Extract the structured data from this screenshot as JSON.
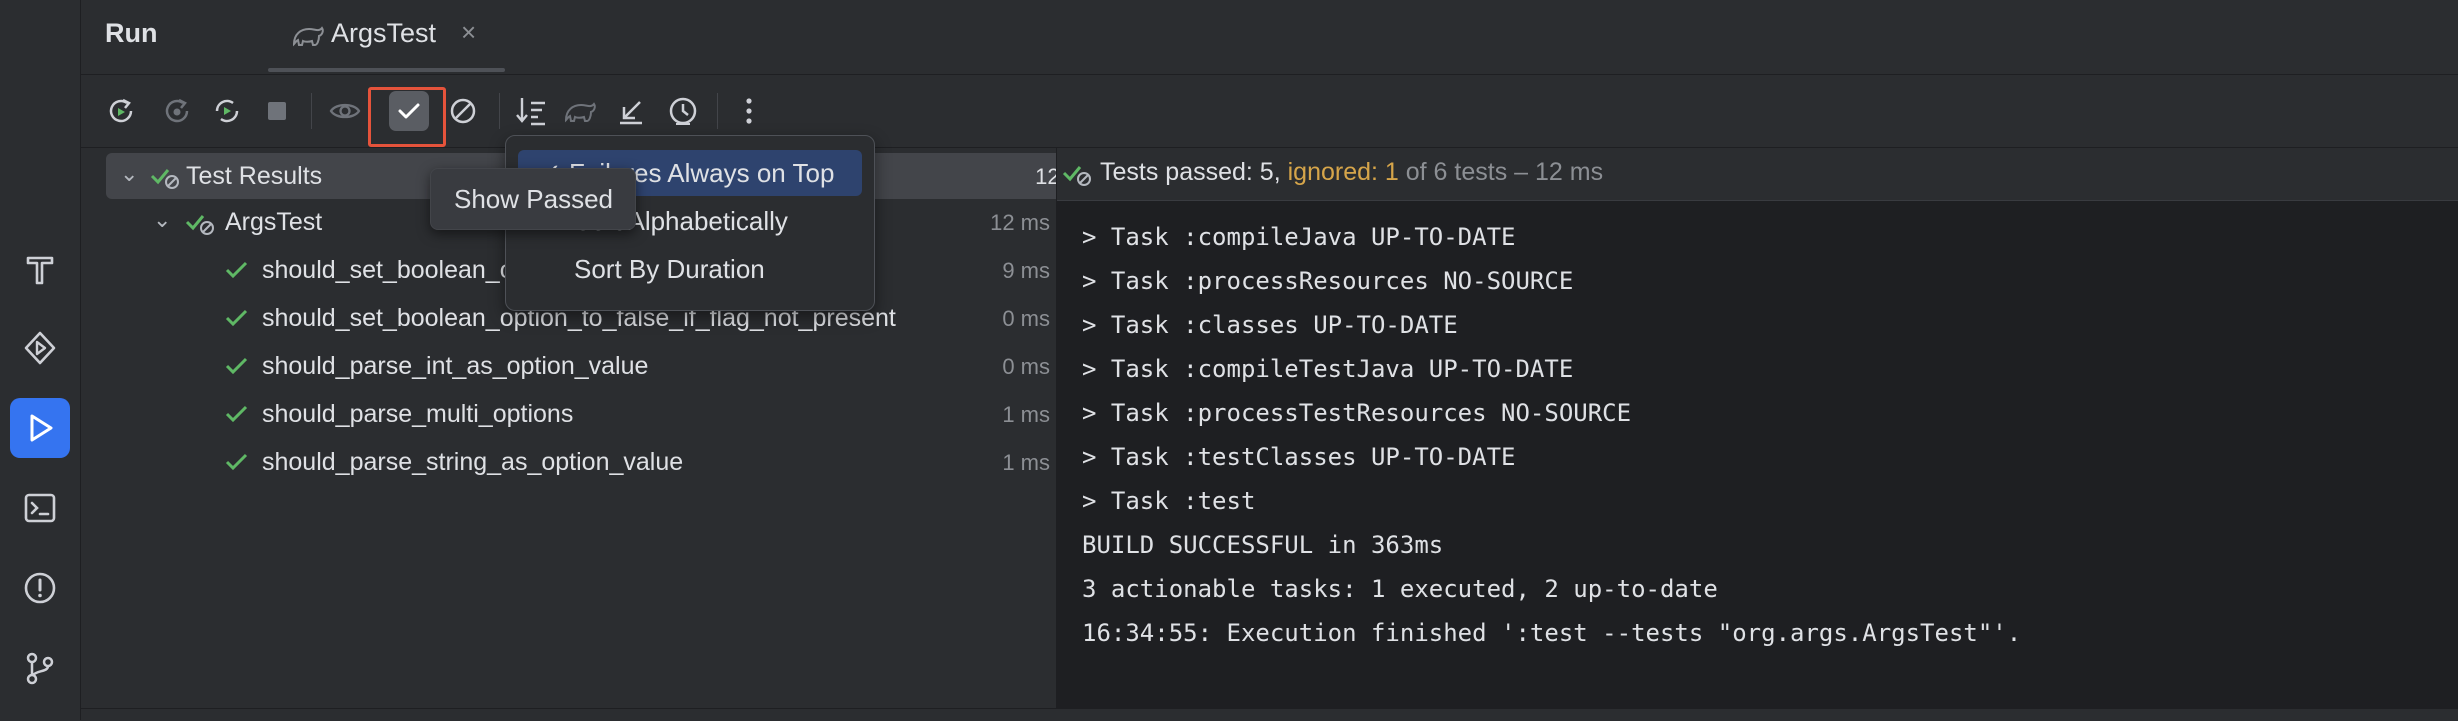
{
  "header": {
    "run_label": "Run",
    "tab_label": "ArgsTest",
    "tab_close": "×"
  },
  "stripe_icons": [
    "build-icon",
    "services-icon",
    "run-icon",
    "terminal-icon",
    "problems-icon",
    "git-icon"
  ],
  "toolbar": {
    "icons": [
      "rerun-icon",
      "rerun-failed-icon",
      "toggle-auto-test-icon",
      "stop-icon",
      "show-ignored-icon",
      "show-passed-icon",
      "hide-excluded-icon",
      "sort-icon",
      "import-tests-icon",
      "export-icon",
      "history-icon",
      "more-icon"
    ]
  },
  "tree": {
    "root": {
      "label": "Test Results",
      "time": "12 ms"
    },
    "suite": {
      "label": "ArgsTest",
      "time": "12 ms"
    },
    "tests": [
      {
        "label": "should_set_boolean_option_to_true_if_flag_present",
        "time": "9 ms"
      },
      {
        "label": "should_set_boolean_option_to_false_if_flag_not_present",
        "time": "0 ms"
      },
      {
        "label": "should_parse_int_as_option_value",
        "time": "0 ms"
      },
      {
        "label": "should_parse_multi_options",
        "time": "1 ms"
      },
      {
        "label": "should_parse_string_as_option_value",
        "time": "1 ms"
      }
    ]
  },
  "summary": {
    "passed": "Tests passed: 5,",
    "ignored": "ignored: 1",
    "rest": "of 6 tests – 12 ms"
  },
  "console": [
    "> Task :compileJava UP-TO-DATE",
    "> Task :processResources NO-SOURCE",
    "> Task :classes UP-TO-DATE",
    "> Task :compileTestJava UP-TO-DATE",
    "> Task :processTestResources NO-SOURCE",
    "> Task :testClasses UP-TO-DATE",
    "> Task :test",
    "BUILD SUCCESSFUL in 363ms",
    "3 actionable tasks: 1 executed, 2 up-to-date",
    "16:34:55: Execution finished ':test --tests \"org.args.ArgsTest\"'."
  ],
  "popup_menu": {
    "items": [
      "✓ Failures Always on Top",
      "Sort Alphabetically",
      "Sort By Duration"
    ]
  },
  "tooltip": {
    "text": "Show Passed"
  },
  "colors": {
    "accent": "#3574f0",
    "pass": "#5fb865",
    "ignored": "#d6a54a",
    "highlight": "#e5533b"
  }
}
